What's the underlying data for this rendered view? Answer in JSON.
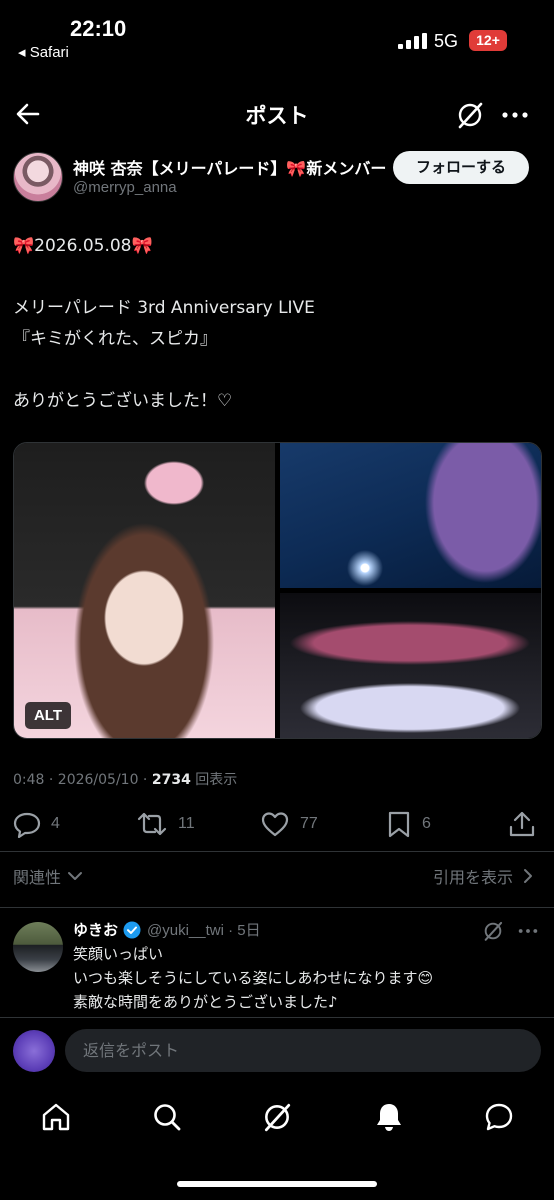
{
  "status_bar": {
    "time": "22:10",
    "back_app": "◂ Safari",
    "network": "5G",
    "battery": "12+"
  },
  "header": {
    "title": "ポスト"
  },
  "post": {
    "author_name": "神咲 杏奈【メリーパレード】🎀新メンバー",
    "author_handle": "@merryp_anna",
    "follow_label": "フォローする",
    "text": "🎀2026.05.08🎀\n\nメリーパレード 3rd Anniversary LIVE\n『キミがくれた、スピカ』\n\nありがとうございました！♡",
    "alt_badge": "ALT",
    "meta_time": "0:48 · 2026/05/10 · ",
    "views_count": "2734",
    "views_label": " 回表示",
    "replies": "4",
    "reposts": "11",
    "likes": "77",
    "bookmarks": "6"
  },
  "sort": {
    "relevance_label": "関連性",
    "quotes_label": "引用を表示"
  },
  "reply": {
    "name": "ゆきお",
    "handle": "@yuki__twi · 5日",
    "text": "笑顔いっぱい\nいつも楽しそうにしている姿にしあわせになります😊\n素敵な時間をありがとうございました♪"
  },
  "composer": {
    "placeholder": "返信をポスト"
  },
  "colors": {
    "background": "#000000",
    "text_primary": "#e7e9ea",
    "text_secondary": "#71767b",
    "verified": "#1d9bf0",
    "battery": "#e03b38"
  },
  "icons": [
    "back-arrow-icon",
    "grok-icon",
    "more-icon",
    "reply-icon",
    "repost-icon",
    "like-icon",
    "bookmark-icon",
    "share-icon",
    "chevron-down-icon",
    "chevron-right-icon",
    "verified-icon",
    "home-icon",
    "search-icon",
    "notifications-icon",
    "messages-icon"
  ]
}
